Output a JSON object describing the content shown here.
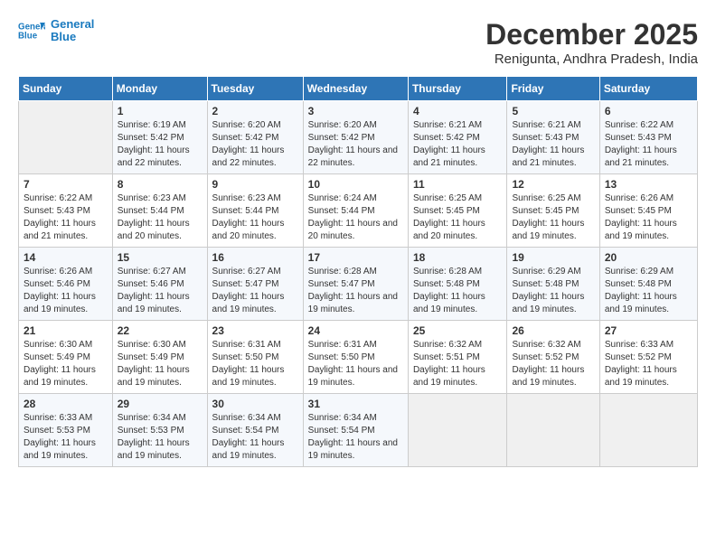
{
  "logo": {
    "line1": "General",
    "line2": "Blue"
  },
  "title": "December 2025",
  "location": "Renigunta, Andhra Pradesh, India",
  "days_of_week": [
    "Sunday",
    "Monday",
    "Tuesday",
    "Wednesday",
    "Thursday",
    "Friday",
    "Saturday"
  ],
  "weeks": [
    [
      {
        "day": "",
        "sunrise": "",
        "sunset": "",
        "daylight": ""
      },
      {
        "day": "1",
        "sunrise": "Sunrise: 6:19 AM",
        "sunset": "Sunset: 5:42 PM",
        "daylight": "Daylight: 11 hours and 22 minutes."
      },
      {
        "day": "2",
        "sunrise": "Sunrise: 6:20 AM",
        "sunset": "Sunset: 5:42 PM",
        "daylight": "Daylight: 11 hours and 22 minutes."
      },
      {
        "day": "3",
        "sunrise": "Sunrise: 6:20 AM",
        "sunset": "Sunset: 5:42 PM",
        "daylight": "Daylight: 11 hours and 22 minutes."
      },
      {
        "day": "4",
        "sunrise": "Sunrise: 6:21 AM",
        "sunset": "Sunset: 5:42 PM",
        "daylight": "Daylight: 11 hours and 21 minutes."
      },
      {
        "day": "5",
        "sunrise": "Sunrise: 6:21 AM",
        "sunset": "Sunset: 5:43 PM",
        "daylight": "Daylight: 11 hours and 21 minutes."
      },
      {
        "day": "6",
        "sunrise": "Sunrise: 6:22 AM",
        "sunset": "Sunset: 5:43 PM",
        "daylight": "Daylight: 11 hours and 21 minutes."
      }
    ],
    [
      {
        "day": "7",
        "sunrise": "Sunrise: 6:22 AM",
        "sunset": "Sunset: 5:43 PM",
        "daylight": "Daylight: 11 hours and 21 minutes."
      },
      {
        "day": "8",
        "sunrise": "Sunrise: 6:23 AM",
        "sunset": "Sunset: 5:44 PM",
        "daylight": "Daylight: 11 hours and 20 minutes."
      },
      {
        "day": "9",
        "sunrise": "Sunrise: 6:23 AM",
        "sunset": "Sunset: 5:44 PM",
        "daylight": "Daylight: 11 hours and 20 minutes."
      },
      {
        "day": "10",
        "sunrise": "Sunrise: 6:24 AM",
        "sunset": "Sunset: 5:44 PM",
        "daylight": "Daylight: 11 hours and 20 minutes."
      },
      {
        "day": "11",
        "sunrise": "Sunrise: 6:25 AM",
        "sunset": "Sunset: 5:45 PM",
        "daylight": "Daylight: 11 hours and 20 minutes."
      },
      {
        "day": "12",
        "sunrise": "Sunrise: 6:25 AM",
        "sunset": "Sunset: 5:45 PM",
        "daylight": "Daylight: 11 hours and 19 minutes."
      },
      {
        "day": "13",
        "sunrise": "Sunrise: 6:26 AM",
        "sunset": "Sunset: 5:45 PM",
        "daylight": "Daylight: 11 hours and 19 minutes."
      }
    ],
    [
      {
        "day": "14",
        "sunrise": "Sunrise: 6:26 AM",
        "sunset": "Sunset: 5:46 PM",
        "daylight": "Daylight: 11 hours and 19 minutes."
      },
      {
        "day": "15",
        "sunrise": "Sunrise: 6:27 AM",
        "sunset": "Sunset: 5:46 PM",
        "daylight": "Daylight: 11 hours and 19 minutes."
      },
      {
        "day": "16",
        "sunrise": "Sunrise: 6:27 AM",
        "sunset": "Sunset: 5:47 PM",
        "daylight": "Daylight: 11 hours and 19 minutes."
      },
      {
        "day": "17",
        "sunrise": "Sunrise: 6:28 AM",
        "sunset": "Sunset: 5:47 PM",
        "daylight": "Daylight: 11 hours and 19 minutes."
      },
      {
        "day": "18",
        "sunrise": "Sunrise: 6:28 AM",
        "sunset": "Sunset: 5:48 PM",
        "daylight": "Daylight: 11 hours and 19 minutes."
      },
      {
        "day": "19",
        "sunrise": "Sunrise: 6:29 AM",
        "sunset": "Sunset: 5:48 PM",
        "daylight": "Daylight: 11 hours and 19 minutes."
      },
      {
        "day": "20",
        "sunrise": "Sunrise: 6:29 AM",
        "sunset": "Sunset: 5:48 PM",
        "daylight": "Daylight: 11 hours and 19 minutes."
      }
    ],
    [
      {
        "day": "21",
        "sunrise": "Sunrise: 6:30 AM",
        "sunset": "Sunset: 5:49 PM",
        "daylight": "Daylight: 11 hours and 19 minutes."
      },
      {
        "day": "22",
        "sunrise": "Sunrise: 6:30 AM",
        "sunset": "Sunset: 5:49 PM",
        "daylight": "Daylight: 11 hours and 19 minutes."
      },
      {
        "day": "23",
        "sunrise": "Sunrise: 6:31 AM",
        "sunset": "Sunset: 5:50 PM",
        "daylight": "Daylight: 11 hours and 19 minutes."
      },
      {
        "day": "24",
        "sunrise": "Sunrise: 6:31 AM",
        "sunset": "Sunset: 5:50 PM",
        "daylight": "Daylight: 11 hours and 19 minutes."
      },
      {
        "day": "25",
        "sunrise": "Sunrise: 6:32 AM",
        "sunset": "Sunset: 5:51 PM",
        "daylight": "Daylight: 11 hours and 19 minutes."
      },
      {
        "day": "26",
        "sunrise": "Sunrise: 6:32 AM",
        "sunset": "Sunset: 5:52 PM",
        "daylight": "Daylight: 11 hours and 19 minutes."
      },
      {
        "day": "27",
        "sunrise": "Sunrise: 6:33 AM",
        "sunset": "Sunset: 5:52 PM",
        "daylight": "Daylight: 11 hours and 19 minutes."
      }
    ],
    [
      {
        "day": "28",
        "sunrise": "Sunrise: 6:33 AM",
        "sunset": "Sunset: 5:53 PM",
        "daylight": "Daylight: 11 hours and 19 minutes."
      },
      {
        "day": "29",
        "sunrise": "Sunrise: 6:34 AM",
        "sunset": "Sunset: 5:53 PM",
        "daylight": "Daylight: 11 hours and 19 minutes."
      },
      {
        "day": "30",
        "sunrise": "Sunrise: 6:34 AM",
        "sunset": "Sunset: 5:54 PM",
        "daylight": "Daylight: 11 hours and 19 minutes."
      },
      {
        "day": "31",
        "sunrise": "Sunrise: 6:34 AM",
        "sunset": "Sunset: 5:54 PM",
        "daylight": "Daylight: 11 hours and 19 minutes."
      },
      {
        "day": "",
        "sunrise": "",
        "sunset": "",
        "daylight": ""
      },
      {
        "day": "",
        "sunrise": "",
        "sunset": "",
        "daylight": ""
      },
      {
        "day": "",
        "sunrise": "",
        "sunset": "",
        "daylight": ""
      }
    ]
  ]
}
